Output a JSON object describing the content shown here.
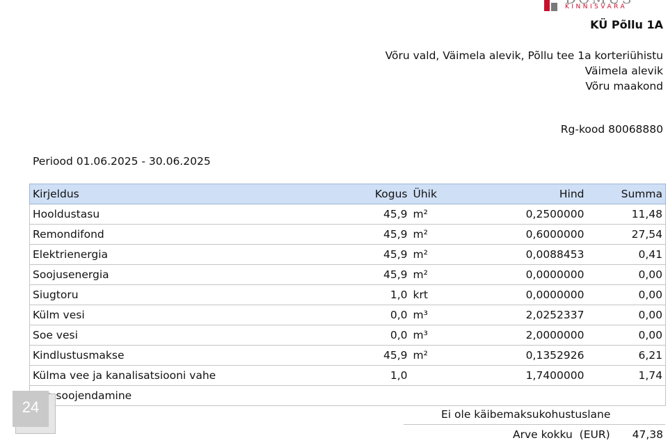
{
  "logo": {
    "word": "DOMUS",
    "sub": "KINNISVARA"
  },
  "header": {
    "title": "KÜ Põllu 1A",
    "address_lines": [
      "Võru vald, Väimela alevik, Põllu tee 1a korteriühistu",
      "Väimela alevik",
      "Võru maakond"
    ],
    "reg_code": "Rg-kood 80068880"
  },
  "period": "Periood 01.06.2025 - 30.06.2025",
  "table": {
    "columns": [
      "Kirjeldus",
      "Kogus",
      "Ühik",
      "Hind",
      "Summa"
    ],
    "rows": [
      [
        "Hooldustasu",
        "45,9",
        "m²",
        "0,2500000",
        "11,48"
      ],
      [
        "Remondifond",
        "45,9",
        "m²",
        "0,6000000",
        "27,54"
      ],
      [
        "Elektrienergia",
        "45,9",
        "m²",
        "0,0088453",
        "0,41"
      ],
      [
        "Soojusenergia",
        "45,9",
        "m²",
        "0,0000000",
        "0,00"
      ],
      [
        "Siugtoru",
        "1,0",
        "krt",
        "0,0000000",
        "0,00"
      ],
      [
        "Külm vesi",
        "0,0",
        "m³",
        "2,0252337",
        "0,00"
      ],
      [
        "Soe vesi",
        "0,0",
        "m³",
        "2,0000000",
        "0,00"
      ],
      [
        "Kindlustusmakse",
        "45,9",
        "m²",
        "0,1352926",
        "6,21"
      ],
      [
        "Külma vee ja kanalisatsiooni vahe",
        "1,0",
        "",
        "1,7400000",
        "1,74"
      ],
      [
        "Vee soojendamine",
        "",
        "",
        "",
        ""
      ]
    ]
  },
  "footer": {
    "vat_note": "Ei ole käibemaksukohustuslane",
    "total_label": "Arve kokku  (EUR)",
    "total_value": "47,38"
  },
  "badge": {
    "label": "24"
  }
}
